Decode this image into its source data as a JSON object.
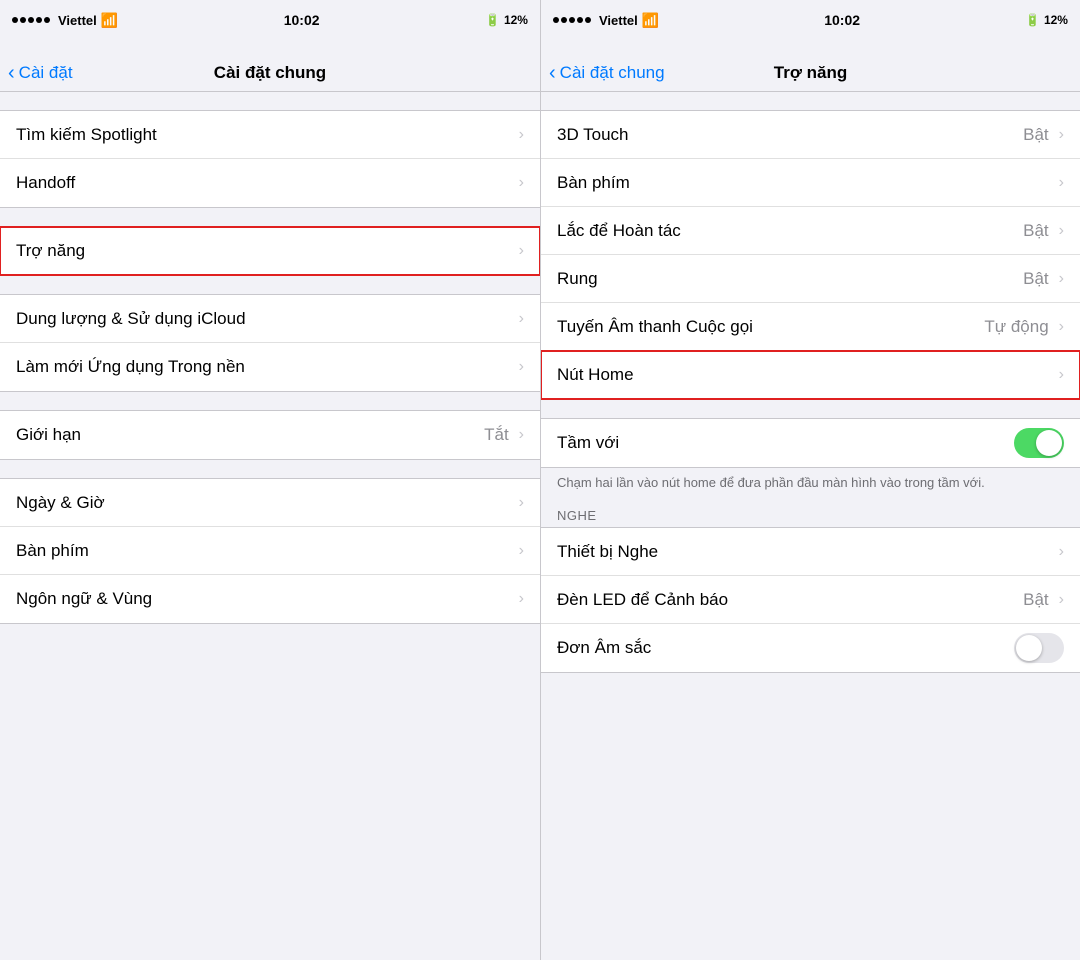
{
  "panel_left": {
    "status": {
      "carrier": "Viettel",
      "time": "10:02",
      "battery_pct": "12%"
    },
    "nav": {
      "back_label": "Cài đặt",
      "title": "Cài đặt chung"
    },
    "sections": [
      {
        "items": [
          {
            "label": "Tìm kiếm Spotlight",
            "value": "",
            "chevron": true
          },
          {
            "label": "Handoff",
            "value": "",
            "chevron": true
          }
        ]
      },
      {
        "items": [
          {
            "label": "Trợ năng",
            "value": "",
            "chevron": true,
            "highlighted": true
          }
        ]
      },
      {
        "items": [
          {
            "label": "Dung lượng & Sử dụng iCloud",
            "value": "",
            "chevron": true
          },
          {
            "label": "Làm mới Ứng dụng Trong nền",
            "value": "",
            "chevron": true
          }
        ]
      },
      {
        "items": [
          {
            "label": "Giới hạn",
            "value": "Tắt",
            "chevron": true
          }
        ]
      },
      {
        "items": [
          {
            "label": "Ngày & Giờ",
            "value": "",
            "chevron": true
          },
          {
            "label": "Bàn phím",
            "value": "",
            "chevron": true
          },
          {
            "label": "Ngôn ngữ & Vùng",
            "value": "",
            "chevron": true
          }
        ]
      }
    ]
  },
  "panel_right": {
    "status": {
      "carrier": "Viettel",
      "time": "10:02",
      "battery_pct": "12%"
    },
    "nav": {
      "back_label": "Cài đặt chung",
      "title": "Trợ năng"
    },
    "sections": [
      {
        "items": [
          {
            "label": "3D Touch",
            "value": "Bật",
            "chevron": true
          },
          {
            "label": "Bàn phím",
            "value": "",
            "chevron": true
          },
          {
            "label": "Lắc để Hoàn tác",
            "value": "Bật",
            "chevron": true
          },
          {
            "label": "Rung",
            "value": "Bật",
            "chevron": true
          },
          {
            "label": "Tuyến Âm thanh Cuộc gọi",
            "value": "Tự động",
            "chevron": true
          },
          {
            "label": "Nút Home",
            "value": "",
            "chevron": true,
            "highlighted": true
          }
        ]
      },
      {
        "items": [
          {
            "label": "Tầm với",
            "value": "",
            "toggle": true,
            "toggle_on": true
          }
        ]
      },
      {
        "footer": "Chạm hai lần vào nút home để đưa phần đầu màn hình vào trong tầm với."
      },
      {
        "section_label": "NGHE",
        "items": [
          {
            "label": "Thiết bị Nghe",
            "value": "",
            "chevron": true
          },
          {
            "label": "Đèn LED để Cảnh báo",
            "value": "Bật",
            "chevron": true
          },
          {
            "label": "Đơn Âm sắc",
            "value": "",
            "toggle": true,
            "toggle_on": false
          }
        ]
      }
    ]
  },
  "icons": {
    "chevron": "›",
    "back_arrow": "‹",
    "wifi": "📶",
    "signal": "●●●●●"
  }
}
